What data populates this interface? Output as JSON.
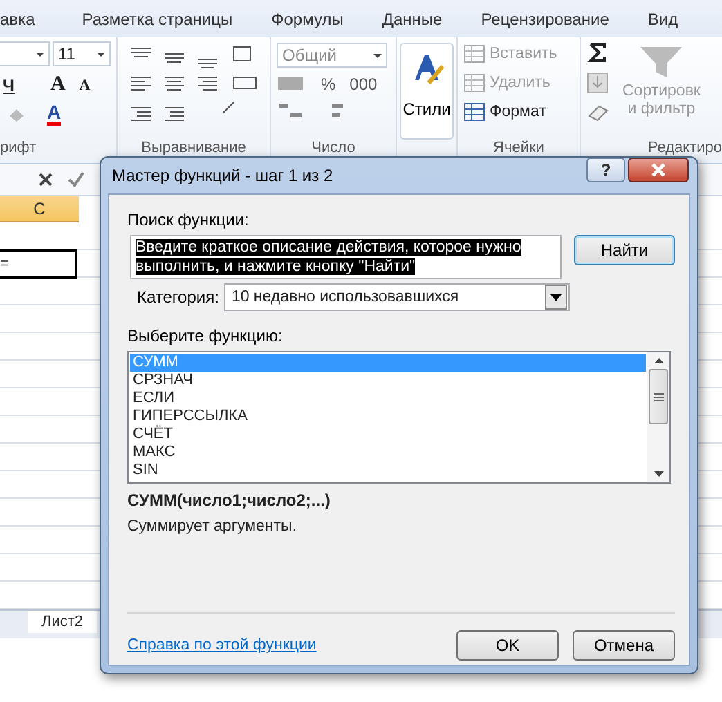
{
  "ribbon_tabs": [
    {
      "label": "авка"
    },
    {
      "label": "Разметка страницы"
    },
    {
      "label": "Формулы"
    },
    {
      "label": "Данные"
    },
    {
      "label": "Рецензирование"
    },
    {
      "label": "Вид"
    }
  ],
  "ribbon": {
    "font": {
      "size": "11",
      "underline": "Ч",
      "grow": "A",
      "shrink": "A",
      "color_button": "A",
      "label": "рифт"
    },
    "alignment": {
      "label": "Выравнивание"
    },
    "number": {
      "format": "Общий",
      "percent": "%",
      "thousands": "000",
      "label": "Число"
    },
    "styles": {
      "button": "Стили"
    },
    "cells": {
      "commands": [
        {
          "label": "Вставить",
          "disabled": true
        },
        {
          "label": "Удалить",
          "disabled": true
        },
        {
          "label": "Формат",
          "disabled": false
        }
      ],
      "label": "Ячейки"
    },
    "editing": {
      "sort_lines": [
        "Сортировк",
        "и фильтр"
      ],
      "label": "Редактиро"
    }
  },
  "sheet": {
    "column": "C",
    "cell_value": "=",
    "sheet_tab": "Лист2"
  },
  "dialog": {
    "title": "Мастер функций - шаг 1 из 2",
    "help_button": "?",
    "search_label": "Поиск функции:",
    "search_value": "Введите краткое описание действия, которое нужно выполнить, и нажмите кнопку \"Найти\"",
    "find_button": "Найти",
    "category_label": "Категория:",
    "category_value": "10 недавно использовавшихся",
    "list_label": "Выберите функцию:",
    "functions": [
      {
        "name": "СУММ",
        "selected": true
      },
      {
        "name": "СРЗНАЧ",
        "selected": false
      },
      {
        "name": "ЕСЛИ",
        "selected": false
      },
      {
        "name": "ГИПЕРССЫЛКА",
        "selected": false
      },
      {
        "name": "СЧЁТ",
        "selected": false
      },
      {
        "name": "МАКС",
        "selected": false
      },
      {
        "name": "SIN",
        "selected": false
      }
    ],
    "signature": "СУММ(число1;число2;...)",
    "description": "Суммирует аргументы.",
    "help_link": "Справка по этой функции",
    "buttons": [
      "OK",
      "Отмена"
    ]
  }
}
